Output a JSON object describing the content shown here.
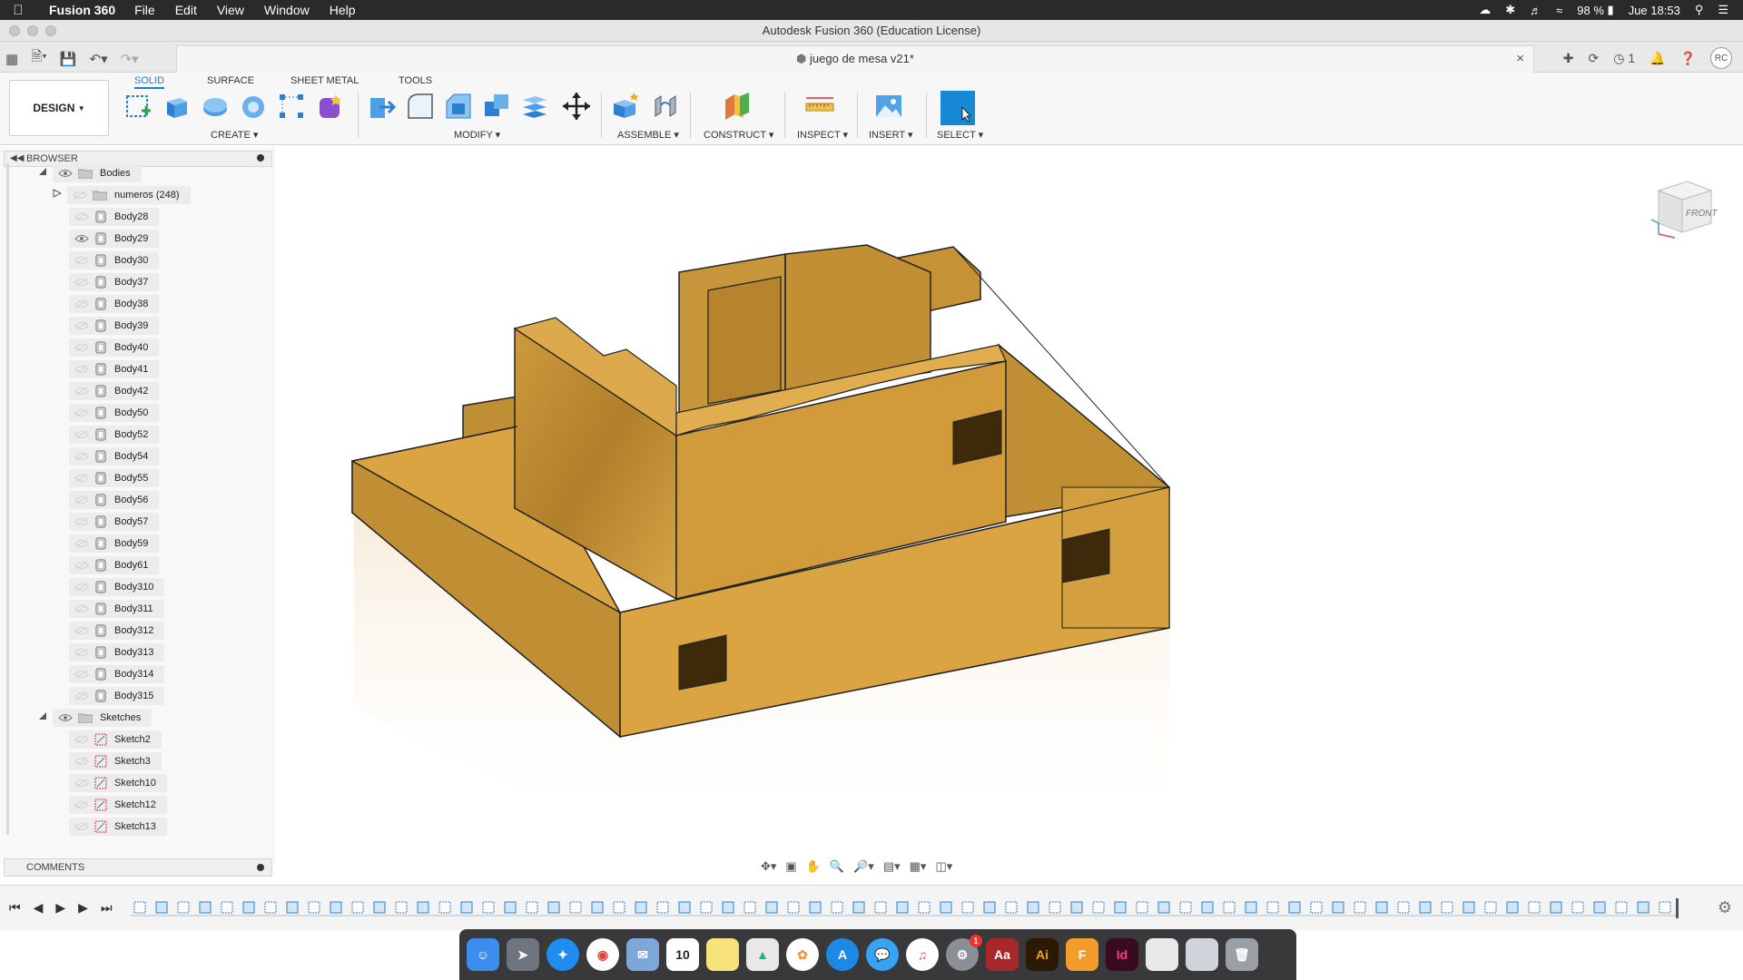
{
  "menubar": {
    "app_name": "Fusion 360",
    "items": [
      "File",
      "Edit",
      "View",
      "Window",
      "Help"
    ],
    "battery": "98 %",
    "clock": "Jue 18:53"
  },
  "window": {
    "title": "Autodesk Fusion 360 (Education License)",
    "doc_tab": "juego de mesa v21*",
    "job_count": "1",
    "user_initials": "RC"
  },
  "ribbon": {
    "workspace": "DESIGN",
    "tabs": [
      "SOLID",
      "SURFACE",
      "SHEET METAL",
      "TOOLS"
    ],
    "groups": {
      "create": "CREATE",
      "modify": "MODIFY",
      "assemble": "ASSEMBLE",
      "construct": "CONSTRUCT",
      "inspect": "INSPECT",
      "insert": "INSERT",
      "select": "SELECT"
    }
  },
  "browser": {
    "title": "BROWSER",
    "bodies_folder": "Bodies",
    "numeros_folder": "numeros (248)",
    "bodies": [
      "Body28",
      "Body29",
      "Body30",
      "Body37",
      "Body38",
      "Body39",
      "Body40",
      "Body41",
      "Body42",
      "Body50",
      "Body52",
      "Body54",
      "Body55",
      "Body56",
      "Body57",
      "Body59",
      "Body61",
      "Body310",
      "Body311",
      "Body312",
      "Body313",
      "Body314",
      "Body315"
    ],
    "sketches_folder": "Sketches",
    "sketches": [
      "Sketch2",
      "Sketch3",
      "Sketch10",
      "Sketch12",
      "Sketch13"
    ]
  },
  "comments": {
    "title": "COMMENTS"
  },
  "viewcube": {
    "face": "FRONT"
  },
  "dock": {
    "calendar_day": "10",
    "notification_badge": "1",
    "apps": [
      "Ai",
      "F",
      "Id"
    ]
  },
  "colors": {
    "model_face": "#d9a441",
    "model_side": "#c08e33",
    "accent": "#1a7fd6"
  }
}
